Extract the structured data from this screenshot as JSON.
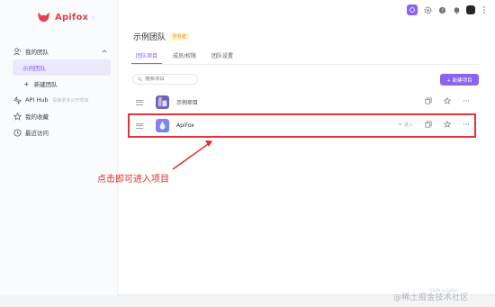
{
  "app": {
    "name": "Apifox"
  },
  "sidebar": {
    "items": [
      {
        "label": "我的团队",
        "icon": "team-icon"
      },
      {
        "label": "示例团队",
        "active": true
      },
      {
        "label": "新建团队",
        "icon": "plus-icon"
      },
      {
        "label": "API Hub",
        "hint": "探索更多公开项目",
        "icon": "api-hub-icon"
      },
      {
        "label": "我的收藏",
        "icon": "star-icon"
      },
      {
        "label": "最近访问",
        "icon": "clock-icon"
      }
    ]
  },
  "team": {
    "title": "示例团队",
    "badge": "所有者"
  },
  "tabs": [
    {
      "label": "团队项目",
      "active": true
    },
    {
      "label": "成员/权限"
    },
    {
      "label": "团队设置"
    }
  ],
  "search": {
    "placeholder": "搜索项目"
  },
  "toolbar": {
    "new_project_label": "+ 新建项目"
  },
  "projects": [
    {
      "name": "示例项目"
    },
    {
      "name": "ApiFox",
      "enter_label": "进入"
    }
  ],
  "annotation": {
    "text": "点击即可进入项目"
  },
  "watermark": {
    "main": "@稀土掘金技术社区",
    "small": "CSDN @ Apifox"
  },
  "colors": {
    "accent": "#8b63f2",
    "brand": "#e5404f",
    "highlight": "#e8323a"
  }
}
